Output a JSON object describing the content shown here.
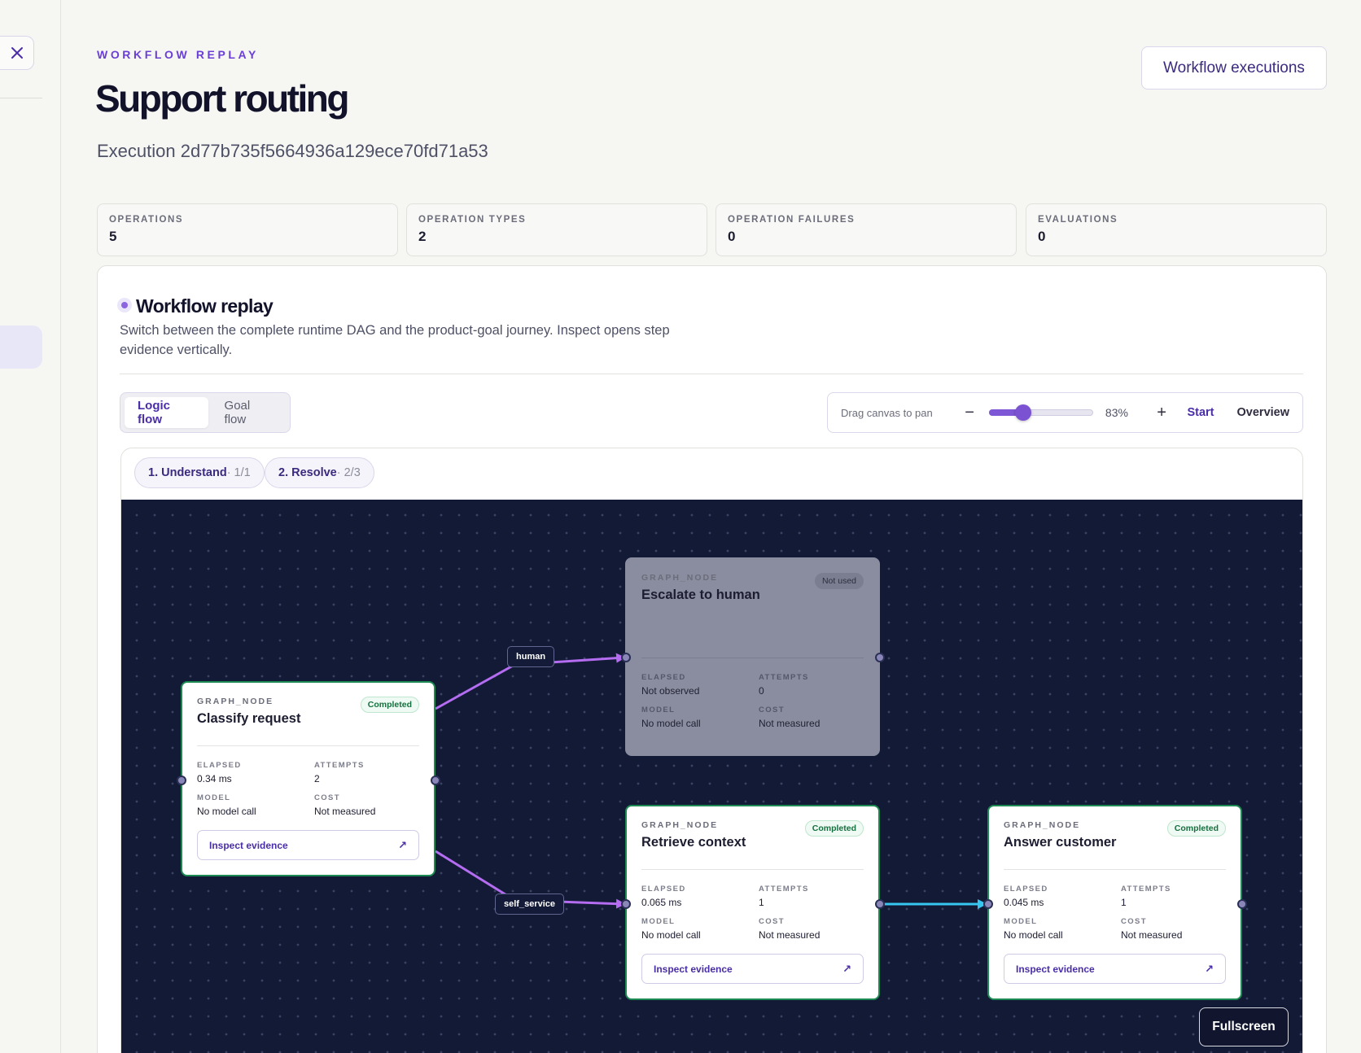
{
  "header": {
    "eyebrow": "WORKFLOW REPLAY",
    "title": "Support routing",
    "execution": "Execution 2d77b735f5664936a129ece70fd71a53",
    "executions_button": "Workflow executions"
  },
  "stats": [
    {
      "label": "OPERATIONS",
      "value": "5"
    },
    {
      "label": "OPERATION TYPES",
      "value": "2"
    },
    {
      "label": "OPERATION FAILURES",
      "value": "0"
    },
    {
      "label": "EVALUATIONS",
      "value": "0"
    }
  ],
  "panel": {
    "title": "Workflow replay",
    "description": "Switch between the complete runtime DAG and the product-goal journey. Inspect opens step evidence vertically."
  },
  "tabs": [
    {
      "label": "Logic flow",
      "active": true
    },
    {
      "label": "Goal flow",
      "active": false
    }
  ],
  "zoom": {
    "hint": "Drag canvas to pan",
    "minus": "−",
    "percent_label": "83%",
    "level": 0.35,
    "plus": "+",
    "start": "Start",
    "overview": "Overview"
  },
  "phases": [
    {
      "label": "1. Understand",
      "count": " · 1/1"
    },
    {
      "label": "2. Resolve",
      "count": " · 2/3"
    }
  ],
  "nodes": {
    "classify": {
      "kind": "GRAPH_NODE",
      "title": "Classify request",
      "status": "Completed",
      "elapsed_label": "ELAPSED",
      "elapsed": "0.34 ms",
      "attempts_label": "ATTEMPTS",
      "attempts": "2",
      "model_label": "MODEL",
      "model": "No model call",
      "cost_label": "COST",
      "cost": "Not measured",
      "inspect": "Inspect evidence"
    },
    "escalate": {
      "kind": "GRAPH_NODE",
      "title": "Escalate to human",
      "status": "Not used",
      "elapsed_label": "ELAPSED",
      "elapsed": "Not observed",
      "attempts_label": "ATTEMPTS",
      "attempts": "0",
      "model_label": "MODEL",
      "model": "No model call",
      "cost_label": "COST",
      "cost": "Not measured"
    },
    "retrieve": {
      "kind": "GRAPH_NODE",
      "title": "Retrieve context",
      "status": "Completed",
      "elapsed_label": "ELAPSED",
      "elapsed": "0.065 ms",
      "attempts_label": "ATTEMPTS",
      "attempts": "1",
      "model_label": "MODEL",
      "model": "No model call",
      "cost_label": "COST",
      "cost": "Not measured",
      "inspect": "Inspect evidence"
    },
    "answer": {
      "kind": "GRAPH_NODE",
      "title": "Answer customer",
      "status": "Completed",
      "elapsed_label": "ELAPSED",
      "elapsed": "0.045 ms",
      "attempts_label": "ATTEMPTS",
      "attempts": "1",
      "model_label": "MODEL",
      "model": "No model call",
      "cost_label": "COST",
      "cost": "Not measured",
      "inspect": "Inspect evidence"
    }
  },
  "edges": {
    "human_label": "human",
    "self_service_label": "self_service"
  },
  "icons": {
    "close": "close-icon",
    "external": "external-link-icon"
  },
  "colors": {
    "accent": "#6a3fd6",
    "completed": "#1e8a53",
    "canvas": "#131a36",
    "edge_route": "#b46cf0",
    "edge_flow": "#36c6f0"
  },
  "fullscreen": "Fullscreen"
}
